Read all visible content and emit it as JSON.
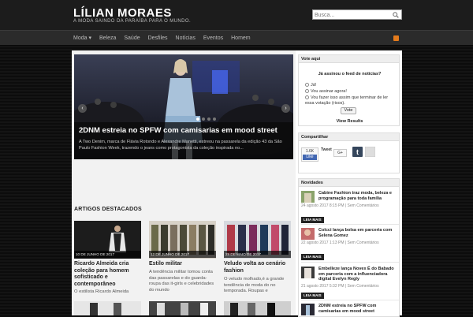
{
  "header": {
    "site_title": "LÍLIAN MORAES",
    "site_description": "A MODA SAINDO DA PARAÍBA PARA O MUNDO.",
    "search_placeholder": "Busca..."
  },
  "nav": {
    "items": [
      {
        "label": "Moda ▾"
      },
      {
        "label": "Beleza"
      },
      {
        "label": "Saúde"
      },
      {
        "label": "Desfiles"
      },
      {
        "label": "Notícias"
      },
      {
        "label": "Eventos"
      },
      {
        "label": "Homem"
      }
    ],
    "rss_icon": "rss-icon"
  },
  "slider": {
    "title": "2DNM estreia no SPFW com camisarias em mood street",
    "excerpt": "A Two Denim, marca de Flávia Rotondo e Alexandre Manetti, estreou na passarela da edição 43 da São Paulo Fashion Week, trazendo o jeans como protagonista da coleção inspirada no...",
    "prev_label": "‹",
    "next_label": "›",
    "slide_count": 4,
    "active_slide": 1
  },
  "featured": {
    "heading": "ARTIGOS DESTACADOS",
    "articles": [
      {
        "date": "10 DE JUNHO DE 2017",
        "title": "Ricardo Almeida cria coleção para homem sofisticado e contemporâneo",
        "excerpt": "O estilista Ricardo Almeida"
      },
      {
        "date": "12 DE JUNHO DE 2017",
        "title": "Estilo militar",
        "excerpt": "A tendência militar tomou conta das passarelas e do guarda-roupa das it-girls e celebridades do mundo"
      },
      {
        "date": "29 DE MAIO DE 2017",
        "title": "Veludo volta ao cenário fashion",
        "excerpt": "O veludo molhado,é a grande tendência de moda do no temporada. Roupas e"
      }
    ]
  },
  "sidebar": {
    "poll": {
      "title": "Vote aqui",
      "question": "Já assinou o feed de notícias?",
      "options": [
        {
          "label": "Já!"
        },
        {
          "label": "Vou assinar agora!"
        },
        {
          "label": "Vou fazer isso assim que terminar de ler essa votação (risos)."
        }
      ],
      "vote_label": "Vote",
      "results_label": "View Results"
    },
    "share": {
      "title": "Compartilhar",
      "fb_count": "1.6K",
      "fb_label": "Like",
      "tweet_label": "Tweet",
      "gplus_label": "G+"
    },
    "news": {
      "title": "Novidades",
      "items": [
        {
          "title": "Cabine Fashion traz moda, beleza e programação para toda família",
          "meta": "24 agosto 2017 8:15 PM | Sem Comentários",
          "more": "LEIA MAIS"
        },
        {
          "title": "Colcci lança bolsa em parceria com Selena Gomez",
          "meta": "22 agosto 2017 1:13 PM | Sem Comentários",
          "more": "LEIA MAIS"
        },
        {
          "title": "Embelleze lança Novex É do Babado em parceria com a influenciadora digital Evelyn Regly",
          "meta": "21 agosto 2017 5:32 PM | Sem Comentários",
          "more": "LEIA MAIS"
        },
        {
          "title": "2DNM estreia no SPFW com camisarias em mood street",
          "meta": "",
          "more": ""
        }
      ]
    }
  }
}
